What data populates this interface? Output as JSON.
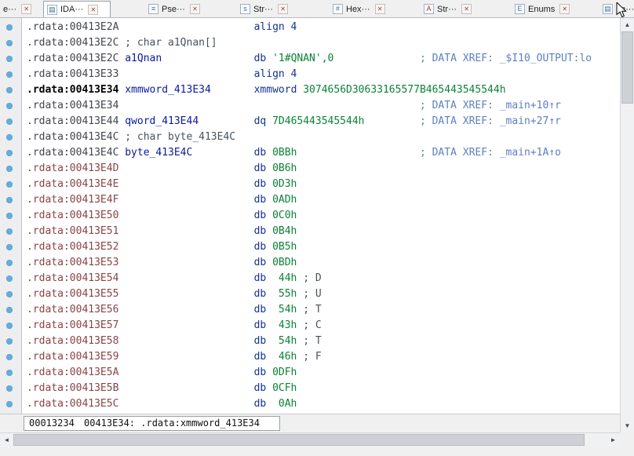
{
  "tabbar": {
    "close_glyph": "✕",
    "tabs": [
      {
        "name": "tab-partial-e",
        "label": "e···",
        "icon": null,
        "glyph": null,
        "active": false,
        "close": true
      },
      {
        "name": "tab-ida-view",
        "label": "IDA···",
        "icon": "ida-view-icon",
        "glyph": "▤",
        "active": true,
        "close": true
      },
      {
        "name": "tab-pseudocode",
        "label": "Pse···",
        "icon": "pseudocode-icon",
        "glyph": "≡",
        "active": false,
        "close": true
      },
      {
        "name": "tab-strings",
        "label": "Str···",
        "icon": "strings-icon",
        "glyph": "s",
        "active": false,
        "close": true
      },
      {
        "name": "tab-hex-view",
        "label": "Hex···",
        "icon": "hexview-icon",
        "glyph": "#",
        "active": false,
        "close": true
      },
      {
        "name": "tab-structures",
        "label": "Str···",
        "icon": "structures-icon",
        "glyph": "A",
        "active": false,
        "close": true,
        "warm_icon": true
      },
      {
        "name": "tab-enums",
        "label": "Enums",
        "icon": "enums-icon",
        "glyph": "E",
        "active": false,
        "close": true
      },
      {
        "name": "tab-imports",
        "label": "Im···",
        "icon": "imports-icon",
        "glyph": "▤",
        "active": false,
        "close": false
      }
    ]
  },
  "listing": {
    "lines": [
      {
        "segs": [
          [
            "addr",
            ".rdata:00413E2A"
          ],
          [
            "plain",
            "                      "
          ],
          [
            "kw",
            "align 4"
          ]
        ]
      },
      {
        "segs": [
          [
            "addr",
            ".rdata:00413E2C"
          ],
          [
            "plain",
            " "
          ],
          [
            "cmt",
            "; char a1Qnan[]"
          ]
        ]
      },
      {
        "segs": [
          [
            "addr",
            ".rdata:00413E2C"
          ],
          [
            "plain",
            " "
          ],
          [
            "name",
            "a1Qnan"
          ],
          [
            "plain",
            "               "
          ],
          [
            "kw",
            "db"
          ],
          [
            "plain",
            " "
          ],
          [
            "str",
            "'1#QNAN',0"
          ],
          [
            "plain",
            "              "
          ],
          [
            "xref",
            "; DATA XREF: _$I10_OUTPUT:lo"
          ]
        ]
      },
      {
        "segs": [
          [
            "addr",
            ".rdata:00413E33"
          ],
          [
            "plain",
            "                      "
          ],
          [
            "kw",
            "align 4"
          ]
        ]
      },
      {
        "segs": [
          [
            "addrc",
            ".rdata:00413E34"
          ],
          [
            "plain",
            " "
          ],
          [
            "name",
            "xmmword_413E34"
          ],
          [
            "plain",
            "       "
          ],
          [
            "kw",
            "xmmword"
          ],
          [
            "plain",
            " "
          ],
          [
            "val",
            "3074656D30633165577B465443545544h"
          ]
        ]
      },
      {
        "segs": [
          [
            "addr",
            ".rdata:00413E34"
          ],
          [
            "plain",
            "                                                 "
          ],
          [
            "xref",
            "; DATA XREF: _main+10↑r"
          ]
        ]
      },
      {
        "segs": [
          [
            "addr",
            ".rdata:00413E44"
          ],
          [
            "plain",
            " "
          ],
          [
            "name",
            "qword_413E44"
          ],
          [
            "plain",
            "         "
          ],
          [
            "kw",
            "dq"
          ],
          [
            "plain",
            " "
          ],
          [
            "val",
            "7D465443545544h"
          ],
          [
            "plain",
            "         "
          ],
          [
            "xref",
            "; DATA XREF: _main+27↑r"
          ]
        ]
      },
      {
        "segs": [
          [
            "addr",
            ".rdata:00413E4C"
          ],
          [
            "plain",
            " "
          ],
          [
            "cmt",
            "; char byte_413E4C"
          ]
        ]
      },
      {
        "segs": [
          [
            "addr",
            ".rdata:00413E4C"
          ],
          [
            "plain",
            " "
          ],
          [
            "name",
            "byte_413E4C"
          ],
          [
            "plain",
            "          "
          ],
          [
            "kw",
            "db"
          ],
          [
            "plain",
            " "
          ],
          [
            "val",
            "0BBh"
          ],
          [
            "plain",
            "                    "
          ],
          [
            "xref",
            "; DATA XREF: _main+1A↑o"
          ]
        ]
      },
      {
        "segs": [
          [
            "addrm",
            ".rdata:00413E4D"
          ],
          [
            "plain",
            "                      "
          ],
          [
            "kw",
            "db"
          ],
          [
            "plain",
            " "
          ],
          [
            "val",
            "0B6h"
          ]
        ]
      },
      {
        "segs": [
          [
            "addrm",
            ".rdata:00413E4E"
          ],
          [
            "plain",
            "                      "
          ],
          [
            "kw",
            "db"
          ],
          [
            "plain",
            " "
          ],
          [
            "val",
            "0D3h"
          ]
        ]
      },
      {
        "segs": [
          [
            "addrm",
            ".rdata:00413E4F"
          ],
          [
            "plain",
            "                      "
          ],
          [
            "kw",
            "db"
          ],
          [
            "plain",
            " "
          ],
          [
            "val",
            "0ADh"
          ]
        ]
      },
      {
        "segs": [
          [
            "addrm",
            ".rdata:00413E50"
          ],
          [
            "plain",
            "                      "
          ],
          [
            "kw",
            "db"
          ],
          [
            "plain",
            " "
          ],
          [
            "val",
            "0C0h"
          ]
        ]
      },
      {
        "segs": [
          [
            "addrm",
            ".rdata:00413E51"
          ],
          [
            "plain",
            "                      "
          ],
          [
            "kw",
            "db"
          ],
          [
            "plain",
            " "
          ],
          [
            "val",
            "0B4h"
          ]
        ]
      },
      {
        "segs": [
          [
            "addrm",
            ".rdata:00413E52"
          ],
          [
            "plain",
            "                      "
          ],
          [
            "kw",
            "db"
          ],
          [
            "plain",
            " "
          ],
          [
            "val",
            "0B5h"
          ]
        ]
      },
      {
        "segs": [
          [
            "addrm",
            ".rdata:00413E53"
          ],
          [
            "plain",
            "                      "
          ],
          [
            "kw",
            "db"
          ],
          [
            "plain",
            " "
          ],
          [
            "val",
            "0BDh"
          ]
        ]
      },
      {
        "segs": [
          [
            "addrm",
            ".rdata:00413E54"
          ],
          [
            "plain",
            "                      "
          ],
          [
            "kw",
            "db"
          ],
          [
            "plain",
            "  "
          ],
          [
            "val",
            "44h"
          ],
          [
            "plain",
            " "
          ],
          [
            "cmt",
            "; D"
          ]
        ]
      },
      {
        "segs": [
          [
            "addrm",
            ".rdata:00413E55"
          ],
          [
            "plain",
            "                      "
          ],
          [
            "kw",
            "db"
          ],
          [
            "plain",
            "  "
          ],
          [
            "val",
            "55h"
          ],
          [
            "plain",
            " "
          ],
          [
            "cmt",
            "; U"
          ]
        ]
      },
      {
        "segs": [
          [
            "addrm",
            ".rdata:00413E56"
          ],
          [
            "plain",
            "                      "
          ],
          [
            "kw",
            "db"
          ],
          [
            "plain",
            "  "
          ],
          [
            "val",
            "54h"
          ],
          [
            "plain",
            " "
          ],
          [
            "cmt",
            "; T"
          ]
        ]
      },
      {
        "segs": [
          [
            "addrm",
            ".rdata:00413E57"
          ],
          [
            "plain",
            "                      "
          ],
          [
            "kw",
            "db"
          ],
          [
            "plain",
            "  "
          ],
          [
            "val",
            "43h"
          ],
          [
            "plain",
            " "
          ],
          [
            "cmt",
            "; C"
          ]
        ]
      },
      {
        "segs": [
          [
            "addrm",
            ".rdata:00413E58"
          ],
          [
            "plain",
            "                      "
          ],
          [
            "kw",
            "db"
          ],
          [
            "plain",
            "  "
          ],
          [
            "val",
            "54h"
          ],
          [
            "plain",
            " "
          ],
          [
            "cmt",
            "; T"
          ]
        ]
      },
      {
        "segs": [
          [
            "addrm",
            ".rdata:00413E59"
          ],
          [
            "plain",
            "                      "
          ],
          [
            "kw",
            "db"
          ],
          [
            "plain",
            "  "
          ],
          [
            "val",
            "46h"
          ],
          [
            "plain",
            " "
          ],
          [
            "cmt",
            "; F"
          ]
        ]
      },
      {
        "segs": [
          [
            "addrm",
            ".rdata:00413E5A"
          ],
          [
            "plain",
            "                      "
          ],
          [
            "kw",
            "db"
          ],
          [
            "plain",
            " "
          ],
          [
            "val",
            "0DFh"
          ]
        ]
      },
      {
        "segs": [
          [
            "addrm",
            ".rdata:00413E5B"
          ],
          [
            "plain",
            "                      "
          ],
          [
            "kw",
            "db"
          ],
          [
            "plain",
            " "
          ],
          [
            "val",
            "0CFh"
          ]
        ]
      },
      {
        "segs": [
          [
            "addrm",
            ".rdata:00413E5C"
          ],
          [
            "plain",
            "                      "
          ],
          [
            "kw",
            "db"
          ],
          [
            "plain",
            "  "
          ],
          [
            "val",
            "0Ah"
          ]
        ]
      }
    ]
  },
  "status": {
    "offset": "00013234",
    "position": "00413E34: .rdata:xmmword_413E34"
  },
  "ui": {
    "scroll_up": "▲",
    "scroll_down": "▼",
    "scroll_left": "◄",
    "scroll_right": "►"
  }
}
